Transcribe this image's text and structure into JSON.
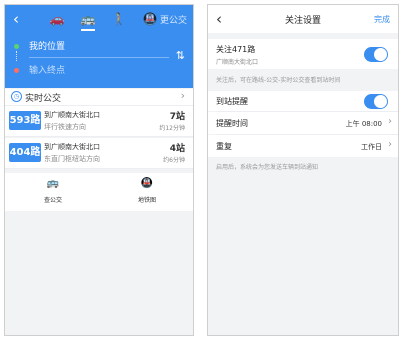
{
  "left": {
    "header": {
      "back_icon": "chevron-left-icon",
      "modes": [
        {
          "name": "car-icon",
          "glyph": "🚗"
        },
        {
          "name": "bus-icon",
          "glyph": "🚌"
        },
        {
          "name": "walk-icon",
          "glyph": "🚶"
        },
        {
          "name": "subway-icon",
          "glyph": "🚇"
        }
      ],
      "more_label": "更公交",
      "start_label": "我的位置",
      "end_placeholder": "输入终点"
    },
    "realtime": {
      "title": "实时公交",
      "routes": [
        {
          "number": "593路",
          "dest": "到广顺南大街北口",
          "direction": "坪行铁速方向",
          "stops": "7站",
          "eta": "约12分钟"
        },
        {
          "number": "404路",
          "dest": "到广顺南大街北口",
          "direction": "东直门枢纽站方向",
          "stops": "4站",
          "eta": "约6分钟"
        }
      ]
    },
    "tools": [
      {
        "label": "查公交",
        "glyph": "🚌"
      },
      {
        "label": "地铁图",
        "glyph": "🚇"
      }
    ]
  },
  "right": {
    "header": {
      "title": "关注设置",
      "done": "完成"
    },
    "follow": {
      "title": "关注471路",
      "subtitle": "广顺南大街北口"
    },
    "follow_hint": "关注后，可在路线-公交-实时公交查看到站时间",
    "arrival": {
      "label": "到站提醒"
    },
    "remind_time": {
      "label": "提醒时间",
      "value": "上午 08:00"
    },
    "repeat": {
      "label": "重复",
      "value": "工作日"
    },
    "repeat_hint": "启用后，系统会为您发送车辆到站通知",
    "accent": "#3a8ef0"
  }
}
